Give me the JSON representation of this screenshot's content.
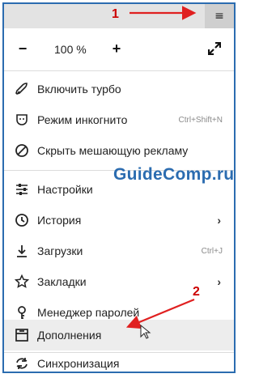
{
  "zoom": {
    "minus_label": "−",
    "value": "100 %",
    "plus_label": "+"
  },
  "menu_button_label": "≡",
  "menu": {
    "turbo": "Включить турбо",
    "incognito": "Режим инкогнито",
    "incognito_shortcut": "Ctrl+Shift+N",
    "adblock": "Скрыть мешающую рекламу",
    "settings": "Настройки",
    "history": "История",
    "downloads": "Загрузки",
    "downloads_shortcut": "Ctrl+J",
    "bookmarks": "Закладки",
    "passwords": "Менеджер паролей",
    "addons": "Дополнения",
    "sync": "Синхронизация"
  },
  "submenu_arrow": "›",
  "watermark": "GuideComp.ru",
  "annotations": {
    "one": "1",
    "two": "2"
  },
  "colors": {
    "arrow": "#e02020",
    "watermark": "#2b6cb0",
    "highlight": "#ededed"
  },
  "icons": [
    "hamburger-icon",
    "fullscreen-icon",
    "rocket-icon",
    "incognito-mask-icon",
    "block-icon",
    "sliders-icon",
    "history-clock-icon",
    "download-icon",
    "star-icon",
    "key-icon",
    "addons-icon",
    "sync-icon",
    "cursor-icon"
  ]
}
